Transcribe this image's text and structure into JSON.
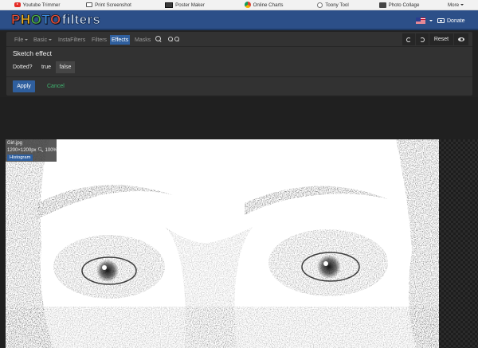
{
  "topbar": {
    "links": [
      {
        "label": "Youtube Trimmer",
        "icon": "youtube-icon"
      },
      {
        "label": "Print Screenshot",
        "icon": "printer-icon"
      },
      {
        "label": "Poster Maker",
        "icon": "poster-icon"
      },
      {
        "label": "Online Charts",
        "icon": "pie-chart-icon"
      },
      {
        "label": "Toony Tool",
        "icon": "toony-icon"
      },
      {
        "label": "Photo Collage",
        "icon": "collage-icon"
      },
      {
        "label": "More"
      }
    ]
  },
  "header": {
    "logo_photo": "PHOTO",
    "logo_filters": "filters",
    "language_icon": "us-flag-icon",
    "donate_label": "Donate"
  },
  "menu": {
    "items": [
      "File",
      "Basic",
      "InstaFilters",
      "Filters",
      "Effects",
      "Masks"
    ],
    "active": "Effects",
    "reset_label": "Reset"
  },
  "effect": {
    "title": "Sketch effect",
    "option_label": "Dotted?",
    "option_true": "true",
    "option_false": "false",
    "selected": "false",
    "apply_label": "Apply",
    "cancel_label": "Cancel"
  },
  "image": {
    "filename": "Girl.jpg",
    "dimensions": "1200×1200px",
    "zoom": "100%",
    "histogram_label": "Histogram"
  },
  "colors": {
    "header_bg": "#2c4f88",
    "accent": "#2f5f9e",
    "cancel_green": "#3fb570",
    "panel_bg": "#323232",
    "page_bg": "#222222"
  }
}
